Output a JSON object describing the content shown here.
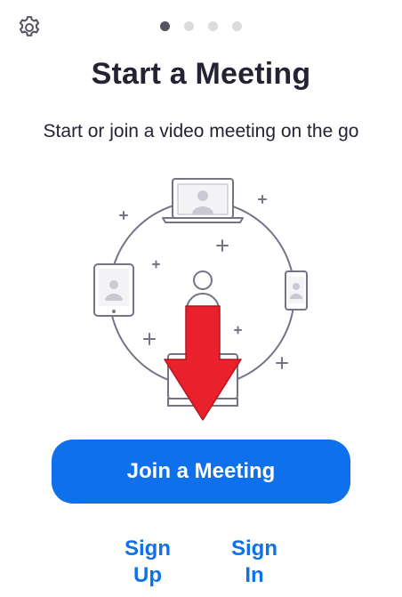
{
  "header": {
    "settings_icon": "gear-icon",
    "pager": {
      "total": 4,
      "active_index": 0
    }
  },
  "main": {
    "title": "Start a Meeting",
    "subtitle": "Start or join a video meeting on the go",
    "illustration_icons": [
      "laptop-icon",
      "tablet-icon",
      "phone-icon",
      "person-icon",
      "desktop-icon",
      "arrow-down-icon"
    ]
  },
  "actions": {
    "join_label": "Join a Meeting",
    "signup_line1": "Sign",
    "signup_line2": "Up",
    "signin_line1": "Sign",
    "signin_line2": "In"
  },
  "colors": {
    "accent": "#0e71eb",
    "text": "#232333",
    "arrow": "#e8212d",
    "illustration_stroke": "#747487"
  }
}
